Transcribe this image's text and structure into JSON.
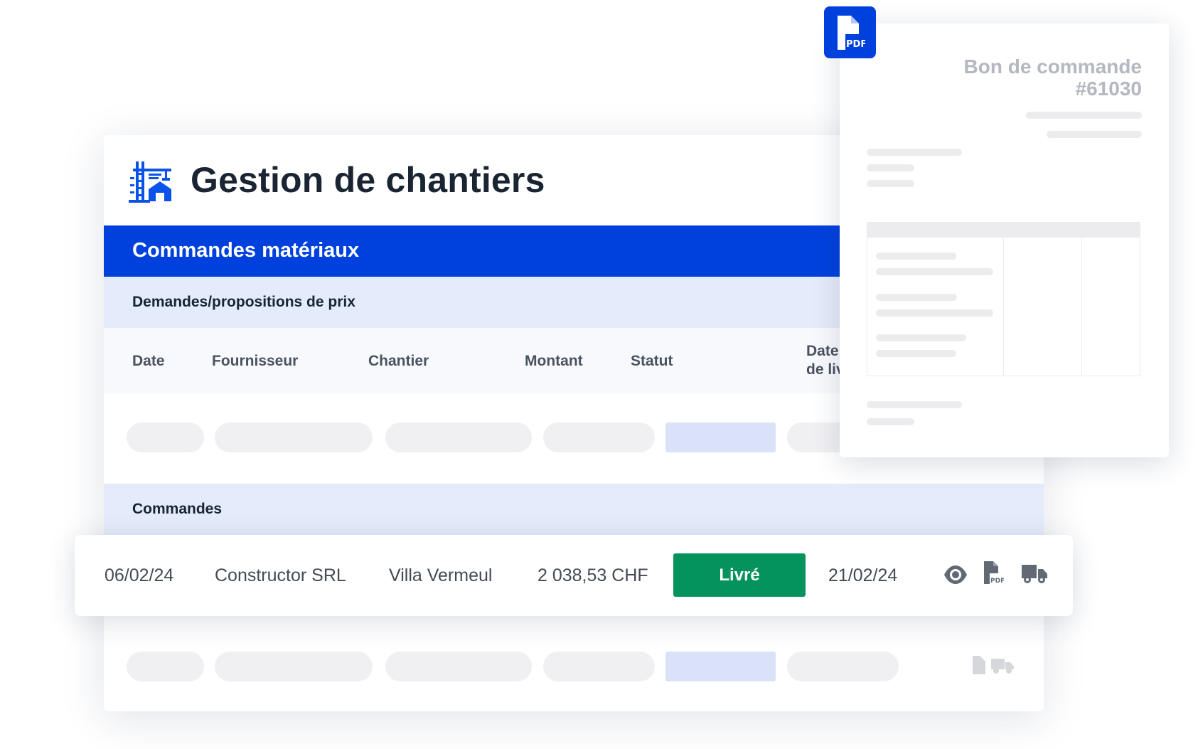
{
  "app": {
    "title": "Gestion de chantiers",
    "icon": "crane-building-icon",
    "accent_color": "#0041dd"
  },
  "section": {
    "title": "Commandes matériaux"
  },
  "quotes": {
    "title": "Demandes/propositions de prix",
    "columns": [
      "Date",
      "Fournisseur",
      "Chantier",
      "Montant",
      "Statut",
      "Date\nde liv"
    ]
  },
  "orders": {
    "title": "Commandes",
    "row": {
      "date": "06/02/24",
      "supplier": "Constructor SRL",
      "site": "Villa Vermeul",
      "amount": "2 038,53 CHF",
      "status": "Livré",
      "status_color": "#04935c",
      "delivery_date": "21/02/24",
      "actions": [
        "eye-icon",
        "pdf-file-icon",
        "truck-icon"
      ]
    }
  },
  "pdf_preview": {
    "title": "Bon de commande",
    "number": "#61030",
    "badge_label": "PDF"
  }
}
